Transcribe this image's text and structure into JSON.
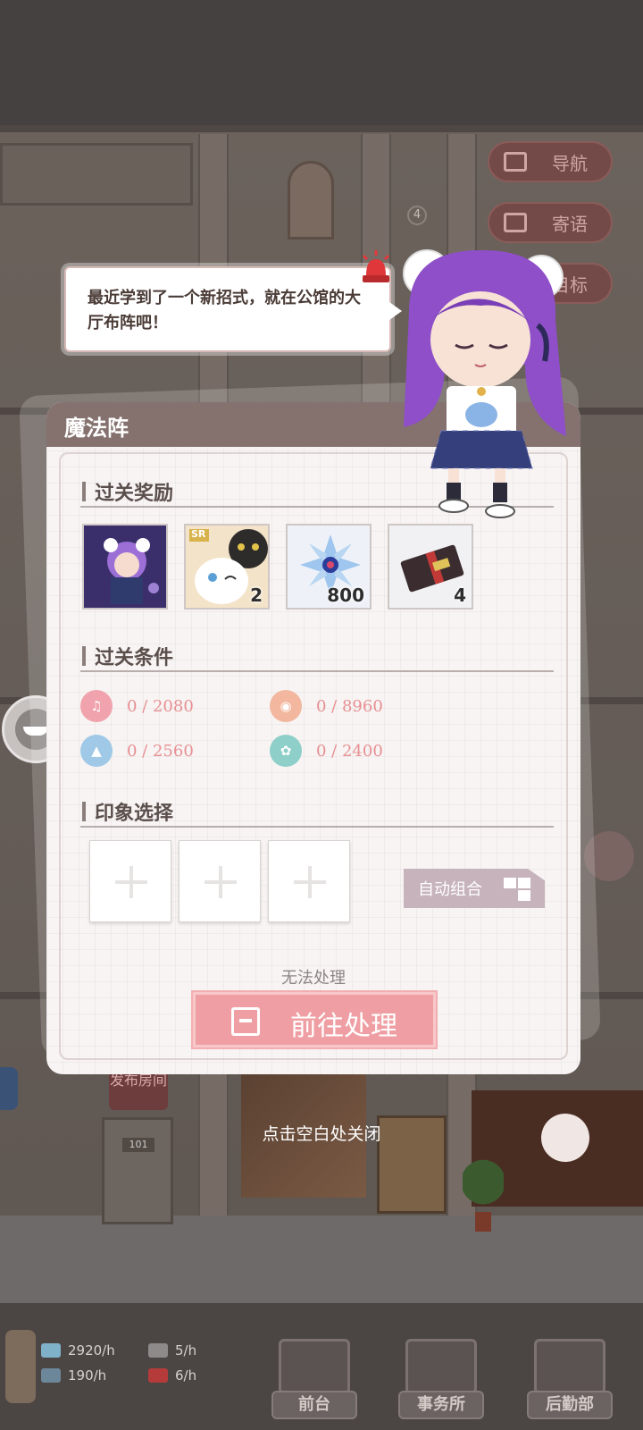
{
  "nav": {
    "items": [
      {
        "label": "导航",
        "icon": "map-icon"
      },
      {
        "label": "寄语",
        "icon": "notebook-icon"
      },
      {
        "label": "目标",
        "icon": "target-icon"
      }
    ]
  },
  "scene": {
    "floor_number": "4",
    "room_sign": "发布房间",
    "door_number": "101"
  },
  "speech": {
    "text": "最近学到了一个新招式，就在公馆的大厅布阵吧！"
  },
  "dialog": {
    "title": "魔法阵",
    "rewards_title": "过关奖励",
    "rewards": [
      {
        "icon": "character-card-icon",
        "count": ""
      },
      {
        "icon": "cat-card-icon",
        "badge": "SR",
        "count": "2"
      },
      {
        "icon": "crystal-icon",
        "count": "800"
      },
      {
        "icon": "ticket-icon",
        "count": "4"
      }
    ],
    "conditions_title": "过关条件",
    "conditions": [
      {
        "icon": "music-icon",
        "value": "0 / 2080",
        "color": "#f0a2ad"
      },
      {
        "icon": "person-icon",
        "value": "0 / 8960",
        "color": "#f2b79e"
      },
      {
        "icon": "graduation-cap-icon",
        "value": "0 / 2560",
        "color": "#9fc9e6"
      },
      {
        "icon": "flower-icon",
        "value": "0 / 2400",
        "color": "#8ecfc9"
      }
    ],
    "impression_title": "印象选择",
    "slots": 3,
    "auto_combine_label": "自动组合",
    "unable_text": "无法处理",
    "go_button_label": "前往处理",
    "close_hint": "点击空白处关闭"
  },
  "bottom": {
    "resources": [
      {
        "icon": "money-icon",
        "value": "2920/h"
      },
      {
        "icon": "person-badge-icon",
        "value": "5/h"
      },
      {
        "icon": "book-icon",
        "value": "190/h"
      },
      {
        "icon": "gift-icon",
        "value": "6/h"
      }
    ],
    "tabs": [
      {
        "label": "前台"
      },
      {
        "label": "事务所"
      },
      {
        "label": "后勤部"
      }
    ]
  },
  "colors": {
    "header": "#85726f",
    "go_button": "#ef9fa3",
    "auto_button": "#c6b3bc",
    "condition_value": "#e88f93"
  }
}
